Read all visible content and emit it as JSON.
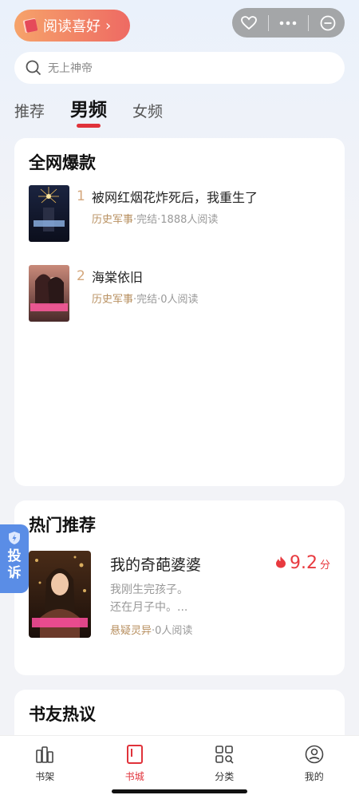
{
  "header": {
    "preference_label": "阅读喜好",
    "preference_chevron": "›"
  },
  "capsule": {
    "favorite_icon": "heart-outline-icon",
    "more_icon": "ellipsis-icon",
    "close_icon": "minus-circle-icon"
  },
  "search": {
    "placeholder": "无上神帝"
  },
  "tabs": [
    {
      "label": "推荐",
      "active": false
    },
    {
      "label": "男频",
      "active": true
    },
    {
      "label": "女频",
      "active": false
    }
  ],
  "ranking": {
    "title": "全网爆款",
    "items": [
      {
        "rank": "1",
        "title": "被网红烟花炸死后，我重生了",
        "category": "历史军事",
        "meta": "·完结·1888人阅读"
      },
      {
        "rank": "2",
        "title": "海棠依旧",
        "category": "历史军事",
        "meta": "·完结·0人阅读"
      }
    ]
  },
  "hot": {
    "title": "热门推荐",
    "book": {
      "title": "我的奇葩婆婆",
      "score": "9.2",
      "score_unit": "分",
      "desc_line1": "我刚生完孩子。",
      "desc_line2": "还在月子中。...",
      "category": "悬疑灵异",
      "meta": "·0人阅读"
    }
  },
  "discussion": {
    "title": "书友热议"
  },
  "complain": {
    "label_line1": "投",
    "label_line2": "诉"
  },
  "nav": [
    {
      "label": "书架",
      "active": false
    },
    {
      "label": "书城",
      "active": true
    },
    {
      "label": "分类",
      "active": false
    },
    {
      "label": "我的",
      "active": false
    }
  ],
  "colors": {
    "accent": "#e0323a",
    "category": "#b89060",
    "rank": "#d4a77c",
    "score": "#e83a3f",
    "complain": "#5a8de6"
  }
}
